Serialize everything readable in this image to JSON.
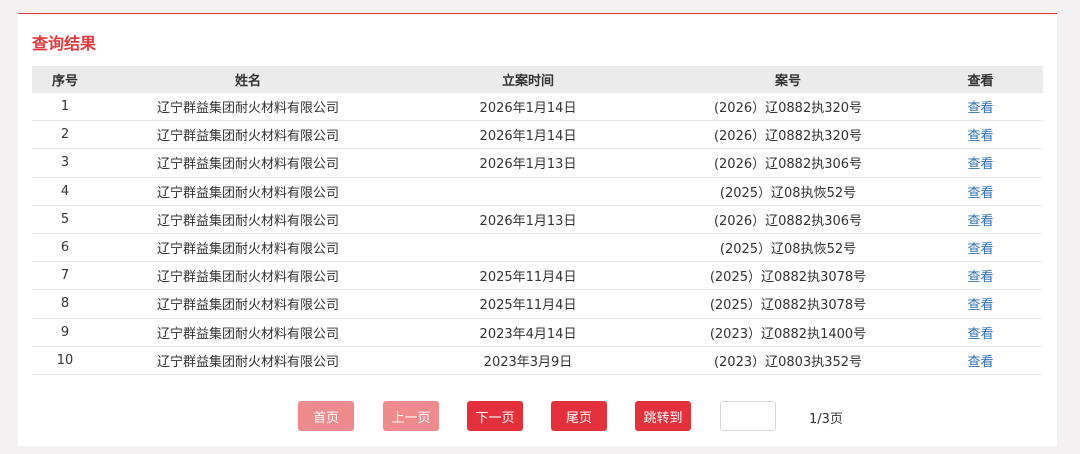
{
  "section_title": "查询结果",
  "table": {
    "headers": [
      "序号",
      "姓名",
      "立案时间",
      "案号",
      "查看"
    ],
    "rows": [
      {
        "no": "1",
        "name": "辽宁群益集团耐火材料有限公司",
        "date": "2026年1月14日",
        "case": "(2026）辽0882执320号",
        "view": "查看"
      },
      {
        "no": "2",
        "name": "辽宁群益集团耐火材料有限公司",
        "date": "2026年1月14日",
        "case": "(2026）辽0882执320号",
        "view": "查看"
      },
      {
        "no": "3",
        "name": "辽宁群益集团耐火材料有限公司",
        "date": "2026年1月13日",
        "case": "(2026）辽0882执306号",
        "view": "查看"
      },
      {
        "no": "4",
        "name": "辽宁群益集团耐火材料有限公司",
        "date": "",
        "case": "(2025）辽08执恢52号",
        "view": "查看"
      },
      {
        "no": "5",
        "name": "辽宁群益集团耐火材料有限公司",
        "date": "2026年1月13日",
        "case": "(2026）辽0882执306号",
        "view": "查看"
      },
      {
        "no": "6",
        "name": "辽宁群益集团耐火材料有限公司",
        "date": "",
        "case": "(2025）辽08执恢52号",
        "view": "查看"
      },
      {
        "no": "7",
        "name": "辽宁群益集团耐火材料有限公司",
        "date": "2025年11月4日",
        "case": "(2025）辽0882执3078号",
        "view": "查看"
      },
      {
        "no": "8",
        "name": "辽宁群益集团耐火材料有限公司",
        "date": "2025年11月4日",
        "case": "(2025）辽0882执3078号",
        "view": "查看"
      },
      {
        "no": "9",
        "name": "辽宁群益集团耐火材料有限公司",
        "date": "2023年4月14日",
        "case": "(2023）辽0882执1400号",
        "view": "查看"
      },
      {
        "no": "10",
        "name": "辽宁群益集团耐火材料有限公司",
        "date": "2023年3月9日",
        "case": "(2023）辽0803执352号",
        "view": "查看"
      }
    ]
  },
  "pager": {
    "first": "首页",
    "prev": "上一页",
    "next": "下一页",
    "last": "尾页",
    "jump": "跳转到",
    "jump_value": "",
    "page_info": "1/3页"
  },
  "colors": {
    "accent": "#e03a3e",
    "button_light": "#ef8a8d",
    "button_dark": "#e3303a",
    "link": "#2f6fb5"
  }
}
